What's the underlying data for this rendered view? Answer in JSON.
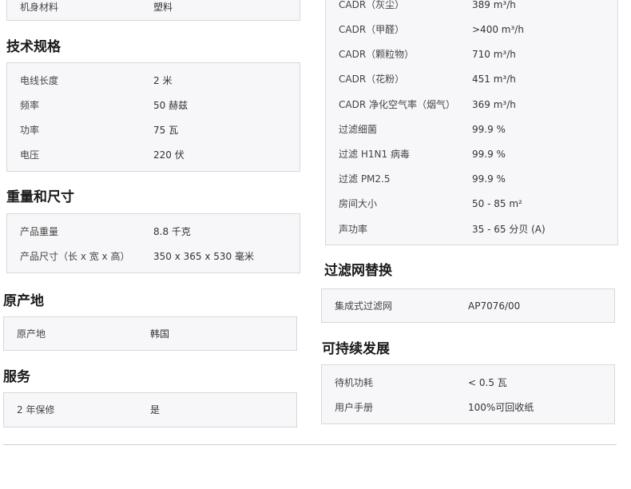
{
  "left": {
    "body_material": {
      "label": "机身材料",
      "value": "塑料"
    },
    "technical_specs": {
      "title": "技术规格",
      "rows": [
        {
          "label": "电线长度",
          "value": "2  米"
        },
        {
          "label": "频率",
          "value": "50  赫兹"
        },
        {
          "label": "功率",
          "value": "75  瓦"
        },
        {
          "label": "电压",
          "value": "220  伏"
        }
      ]
    },
    "weight_size": {
      "title": "重量和尺寸",
      "rows": [
        {
          "label": "产品重量",
          "value": "8.8  千克"
        },
        {
          "label": "产品尺寸（长 x 宽 x 高）",
          "value": "350 x 365 x 530  毫米"
        }
      ]
    },
    "origin": {
      "title": "原产地",
      "rows": [
        {
          "label": "原产地",
          "value": "韩国"
        }
      ]
    },
    "service": {
      "title": "服务",
      "rows": [
        {
          "label": "2 年保修",
          "value": "是"
        }
      ]
    }
  },
  "right": {
    "performance": {
      "rows": [
        {
          "label": "CADR（灰尘）",
          "value": "389  m³/h"
        },
        {
          "label": "CADR（甲醛）",
          "value": ">400  m³/h"
        },
        {
          "label": "CADR（颗粒物）",
          "value": "710  m³/h"
        },
        {
          "label": "CADR（花粉）",
          "value": "451  m³/h"
        },
        {
          "label": "CADR 净化空气率（烟气）",
          "value": "369  m³/h"
        },
        {
          "label": "过滤细菌",
          "value": "99.9  %"
        },
        {
          "label": "过滤 H1N1 病毒",
          "value": "99.9  %"
        },
        {
          "label": "过滤 PM2.5",
          "value": "99.9  %"
        },
        {
          "label": "房间大小",
          "value": "50 - 85  m²"
        },
        {
          "label": "声功率",
          "value": "35 - 65  分贝 (A)"
        }
      ]
    },
    "filter_replacement": {
      "title": "过滤网替换",
      "rows": [
        {
          "label": "集成式过滤网",
          "value": "AP7076/00"
        }
      ]
    },
    "sustainability": {
      "title": "可持续发展",
      "rows": [
        {
          "label": "待机功耗",
          "value": "< 0.5  瓦"
        },
        {
          "label": "用户手册",
          "value": "100%可回收纸"
        }
      ]
    }
  }
}
